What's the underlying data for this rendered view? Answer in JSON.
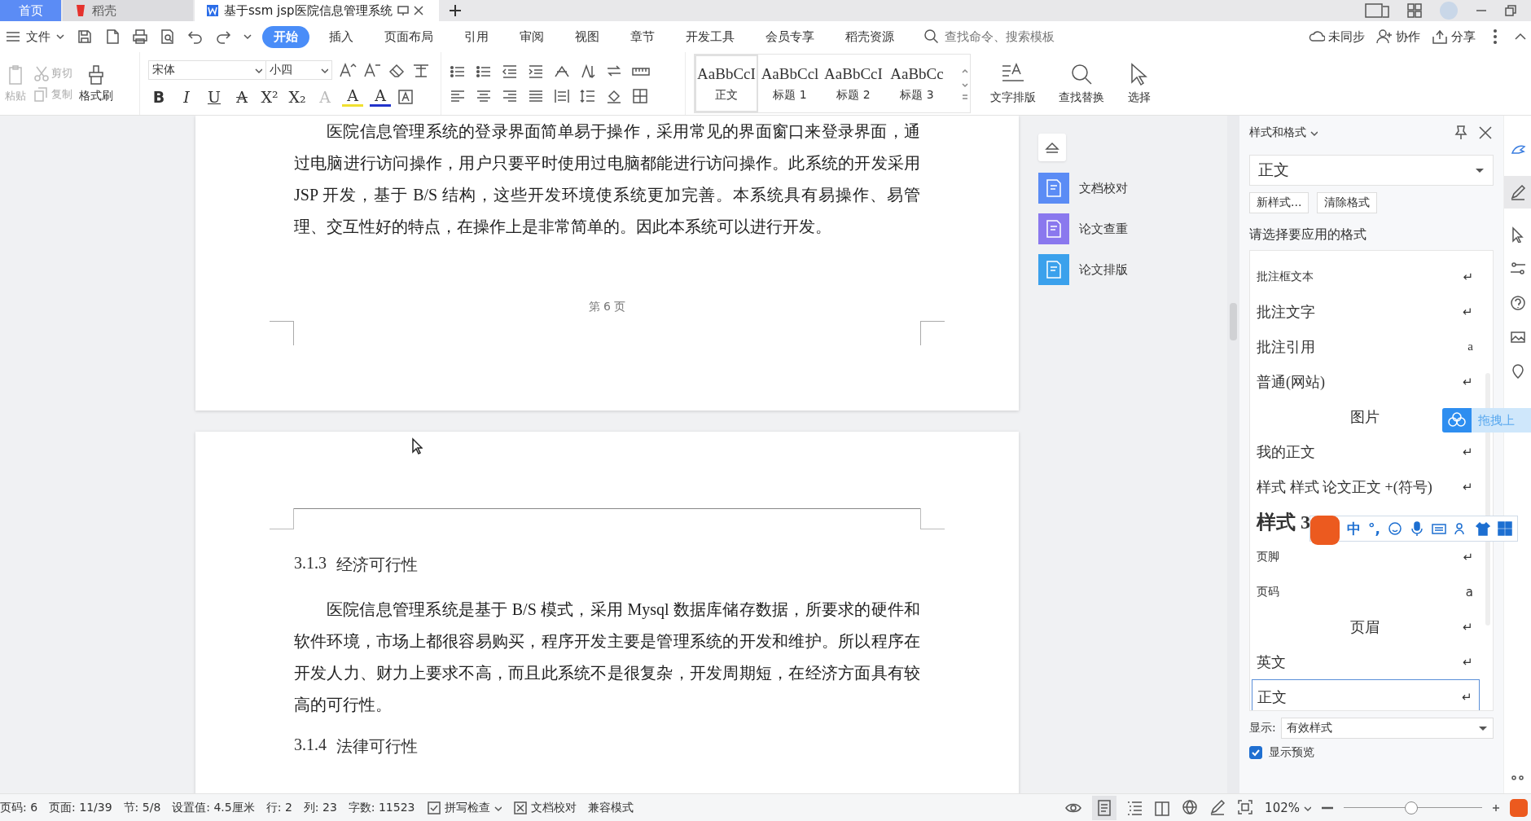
{
  "tabs": [
    {
      "label": "首页",
      "kind": "home",
      "selected": false
    },
    {
      "label": "稻壳",
      "kind": "docer",
      "selected": false
    },
    {
      "label": "基于ssm jsp医院信息管理系统",
      "kind": "doc",
      "selected": true
    }
  ],
  "menu": {
    "file": "文件",
    "tabs": [
      {
        "label": "开始",
        "selected": true
      },
      {
        "label": "插入",
        "selected": false
      },
      {
        "label": "页面布局",
        "selected": false
      },
      {
        "label": "引用",
        "selected": false
      },
      {
        "label": "审阅",
        "selected": false
      },
      {
        "label": "视图",
        "selected": false
      },
      {
        "label": "章节",
        "selected": false
      },
      {
        "label": "开发工具",
        "selected": false
      },
      {
        "label": "会员专享",
        "selected": false
      },
      {
        "label": "稻壳资源",
        "selected": false
      }
    ],
    "search": {
      "placeholder": "查找命令、搜索模板"
    },
    "actions": [
      "未同步",
      "协作",
      "分享"
    ]
  },
  "ribbon": {
    "clipboard": [
      {
        "label": "粘贴",
        "disabled": true
      },
      {
        "label": "剪切",
        "disabled": true
      },
      {
        "label": "复制",
        "disabled": true
      },
      {
        "label": "格式刷",
        "disabled": false
      }
    ],
    "font": "宋体",
    "size": "小四",
    "format_glyphs": [
      "B",
      "I",
      "U",
      "A",
      "X²",
      "X₂",
      "A",
      "A",
      "A"
    ],
    "styles": [
      {
        "preview": "AaBbCcI",
        "label": "正文",
        "selected": true
      },
      {
        "preview": "AaBbCcl",
        "label": "标题 1",
        "selected": false
      },
      {
        "preview": "AaBbCcI",
        "label": "标题 2",
        "selected": false
      },
      {
        "preview": "AaBbCc",
        "label": "标题 3",
        "selected": false
      }
    ],
    "tools": [
      "文字排版",
      "查找替换",
      "选择"
    ]
  },
  "document": {
    "page1": {
      "paragraphs": [
        "医院信息管理系统的登录界面简单易于操作，采用常见的界面窗口来登录界面，通过电脑进行访问操作，用户只要平时使用过电脑都能进行访问操作。此系统的开发采用 JSP 开发，基于 B/S 结构，这些开发环境使系统更加完善。本系统具有易操作、易管理、交互性好的特点，在操作上是非常简单的。因此本系统可以进行开发。"
      ],
      "footer": "第 6 页"
    },
    "page2": {
      "blocks": [
        {
          "kind": "heading",
          "number": "3.1.3",
          "text": "经济可行性"
        },
        {
          "kind": "para",
          "text": "医院信息管理系统是基于 B/S 模式，采用 Mysql 数据库储存数据，所要求的硬件和软件环境，市场上都很容易购买，程序开发主要是管理系统的开发和维护。所以程序在开发人力、财力上要求不高，而且此系统不是很复杂，开发周期短，在经济方面具有较高的可行性。"
        },
        {
          "kind": "heading",
          "number": "3.1.4",
          "text": "法律可行性"
        }
      ]
    }
  },
  "side_buttons": [
    {
      "label": "文档校对",
      "color": "#5b8cf5"
    },
    {
      "label": "论文查重",
      "color": "#8a78ee"
    },
    {
      "label": "论文排版",
      "color": "#3ba1ec"
    }
  ],
  "panel": {
    "title": "样式和格式",
    "current": "正文",
    "buttons": [
      "新样式...",
      "清除格式"
    ],
    "prompt": "请选择要应用的格式",
    "styles": [
      {
        "name": "批注框文本",
        "kind": "small",
        "mark": "↵",
        "selected": false
      },
      {
        "name": "批注文字",
        "kind": "serif",
        "mark": "↵",
        "selected": false
      },
      {
        "name": "批注引用",
        "kind": "serif",
        "mark": "a",
        "selected": false
      },
      {
        "name": "普通(网站)",
        "kind": "serif",
        "mark": "↵",
        "selected": false
      },
      {
        "name": "图片",
        "kind": "center",
        "selected": false
      },
      {
        "name": "我的正文",
        "kind": "serif",
        "mark": "↵",
        "selected": false
      },
      {
        "name": "样式 样式 论文正文 +(符号)",
        "kind": "serif",
        "mark": "↵",
        "selected": false
      },
      {
        "name": "样式 3",
        "kind": "bold",
        "selected": false
      },
      {
        "name": "页脚",
        "kind": "small",
        "mark": "↵",
        "selected": false
      },
      {
        "name": "页码",
        "kind": "small",
        "mark": "a",
        "selected": false
      },
      {
        "name": "页眉",
        "kind": "center",
        "mark": "↵",
        "selected": false
      },
      {
        "name": "英文",
        "kind": "serif",
        "mark": "↵",
        "selected": false
      },
      {
        "name": "正文",
        "kind": "serif",
        "mark": "↵",
        "selected": true
      }
    ],
    "show_label": "显示:",
    "show_value": "有效样式",
    "preview": {
      "label": "显示预览",
      "checked": true
    }
  },
  "ime": {
    "labels": [
      "中",
      "°,"
    ]
  },
  "upload": {
    "label": "拖拽上"
  },
  "status": {
    "items": [
      "页码: 6",
      "页面: 11/39",
      "节: 5/8",
      "设置值: 4.5厘米",
      "行: 2",
      "列: 23",
      "字数: 11523"
    ],
    "spell": "拼写检查",
    "proof": "文档校对",
    "mode": "兼容模式",
    "zoom": {
      "text": "102%",
      "level": 0.49
    }
  }
}
